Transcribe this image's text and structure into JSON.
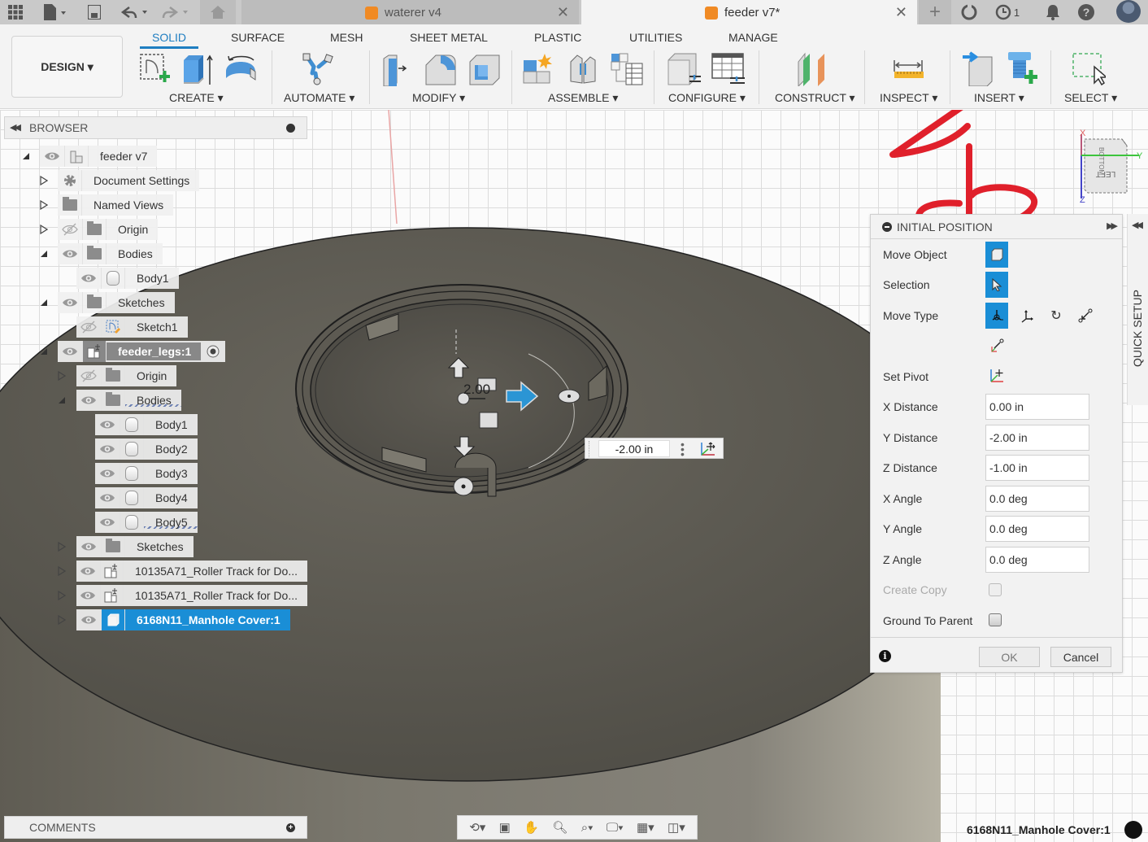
{
  "titlebar": {
    "tabs": [
      {
        "label": "waterer v4",
        "active": false
      },
      {
        "label": "feeder v7*",
        "active": true
      }
    ],
    "job_count": "1"
  },
  "ribbon": {
    "workspace_button": "DESIGN ▾",
    "tabs": [
      "SOLID",
      "SURFACE",
      "MESH",
      "SHEET METAL",
      "PLASTIC",
      "UTILITIES",
      "MANAGE"
    ],
    "active_tab": "SOLID",
    "groups": [
      {
        "label": "CREATE ▾"
      },
      {
        "label": "AUTOMATE ▾"
      },
      {
        "label": "MODIFY ▾"
      },
      {
        "label": "ASSEMBLE ▾"
      },
      {
        "label": "CONFIGURE ▾"
      },
      {
        "label": "CONSTRUCT ▾"
      },
      {
        "label": "INSPECT ▾"
      },
      {
        "label": "INSERT ▾"
      },
      {
        "label": "SELECT ▾"
      }
    ],
    "accent_color": "#1f7ec1"
  },
  "annotation": {
    "color": "#e0202b",
    "target": "INSERT"
  },
  "browser": {
    "title": "BROWSER",
    "nodes": [
      {
        "label": "feeder v7"
      },
      {
        "label": "Document Settings"
      },
      {
        "label": "Named Views"
      },
      {
        "label": "Origin"
      },
      {
        "label": "Bodies"
      },
      {
        "label": "Body1"
      },
      {
        "label": "Sketches"
      },
      {
        "label": "Sketch1"
      },
      {
        "label": "feeder_legs:1"
      },
      {
        "label": "Origin"
      },
      {
        "label": "Bodies"
      },
      {
        "label": "Body1"
      },
      {
        "label": "Body2"
      },
      {
        "label": "Body3"
      },
      {
        "label": "Body4"
      },
      {
        "label": "Body5"
      },
      {
        "label": "Sketches"
      },
      {
        "label": "10135A71_Roller Track for Do..."
      },
      {
        "label": "10135A71_Roller Track for Do..."
      },
      {
        "label": "6168N11_Manhole Cover:1"
      }
    ]
  },
  "comments": {
    "title": "COMMENTS"
  },
  "viewport": {
    "manipulator_label": "2.00",
    "distance_input": "-2.00 in",
    "viewcube_face": "LEFT",
    "viewcube_top": "BOTTOM",
    "axes": {
      "x": "X",
      "y": "Y",
      "z": "Z"
    }
  },
  "dialog": {
    "title": "INITIAL POSITION",
    "rows": {
      "move_object": "Move Object",
      "selection": "Selection",
      "move_type": "Move Type",
      "set_pivot": "Set Pivot",
      "x_distance": "X Distance",
      "y_distance": "Y Distance",
      "z_distance": "Z Distance",
      "x_angle": "X Angle",
      "y_angle": "Y Angle",
      "z_angle": "Z Angle",
      "create_copy": "Create Copy",
      "ground_to_parent": "Ground To Parent"
    },
    "values": {
      "x_distance": "0.00 in",
      "y_distance": "-2.00 in",
      "z_distance": "-1.00 in",
      "x_angle": "0.0 deg",
      "y_angle": "0.0 deg",
      "z_angle": "0.0 deg"
    },
    "create_copy_checked": false,
    "ground_to_parent_checked": false,
    "ok": "OK",
    "cancel": "Cancel",
    "accent_color": "#1a8ed6"
  },
  "quick_setup": {
    "label": "QUICK SETUP"
  },
  "status": {
    "selection": "6168N11_Manhole Cover:1"
  }
}
